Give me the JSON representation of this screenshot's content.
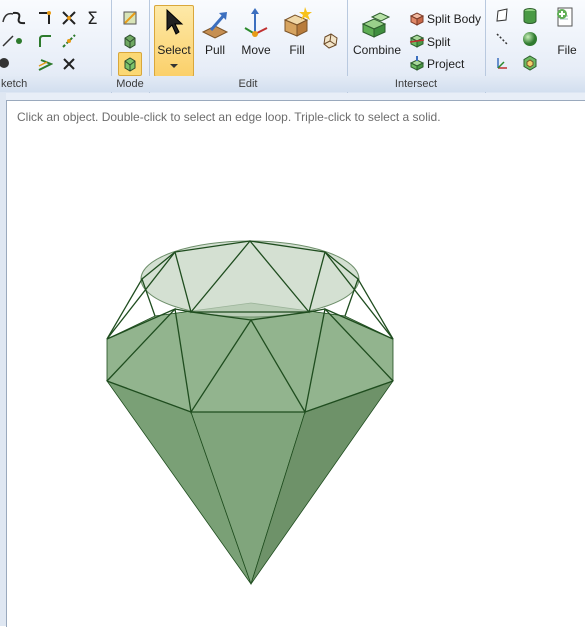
{
  "ribbon": {
    "groups": {
      "sketch": "ketch",
      "mode": "Mode",
      "edit": "Edit",
      "intersect": "Intersect"
    },
    "edit": {
      "select": "Select",
      "pull": "Pull",
      "move": "Move",
      "fill": "Fill"
    },
    "intersect": {
      "combine": "Combine",
      "split_body": "Split Body",
      "split": "Split",
      "project": "Project"
    },
    "insert": {
      "file": "File"
    }
  },
  "viewport": {
    "hint": "Click an object. Double-click to select an edge loop. Triple-click to select a solid."
  },
  "colors": {
    "accent_select": "#fbd874",
    "solid_fill": "#7fa27c",
    "solid_edge": "#1f4d1f"
  }
}
